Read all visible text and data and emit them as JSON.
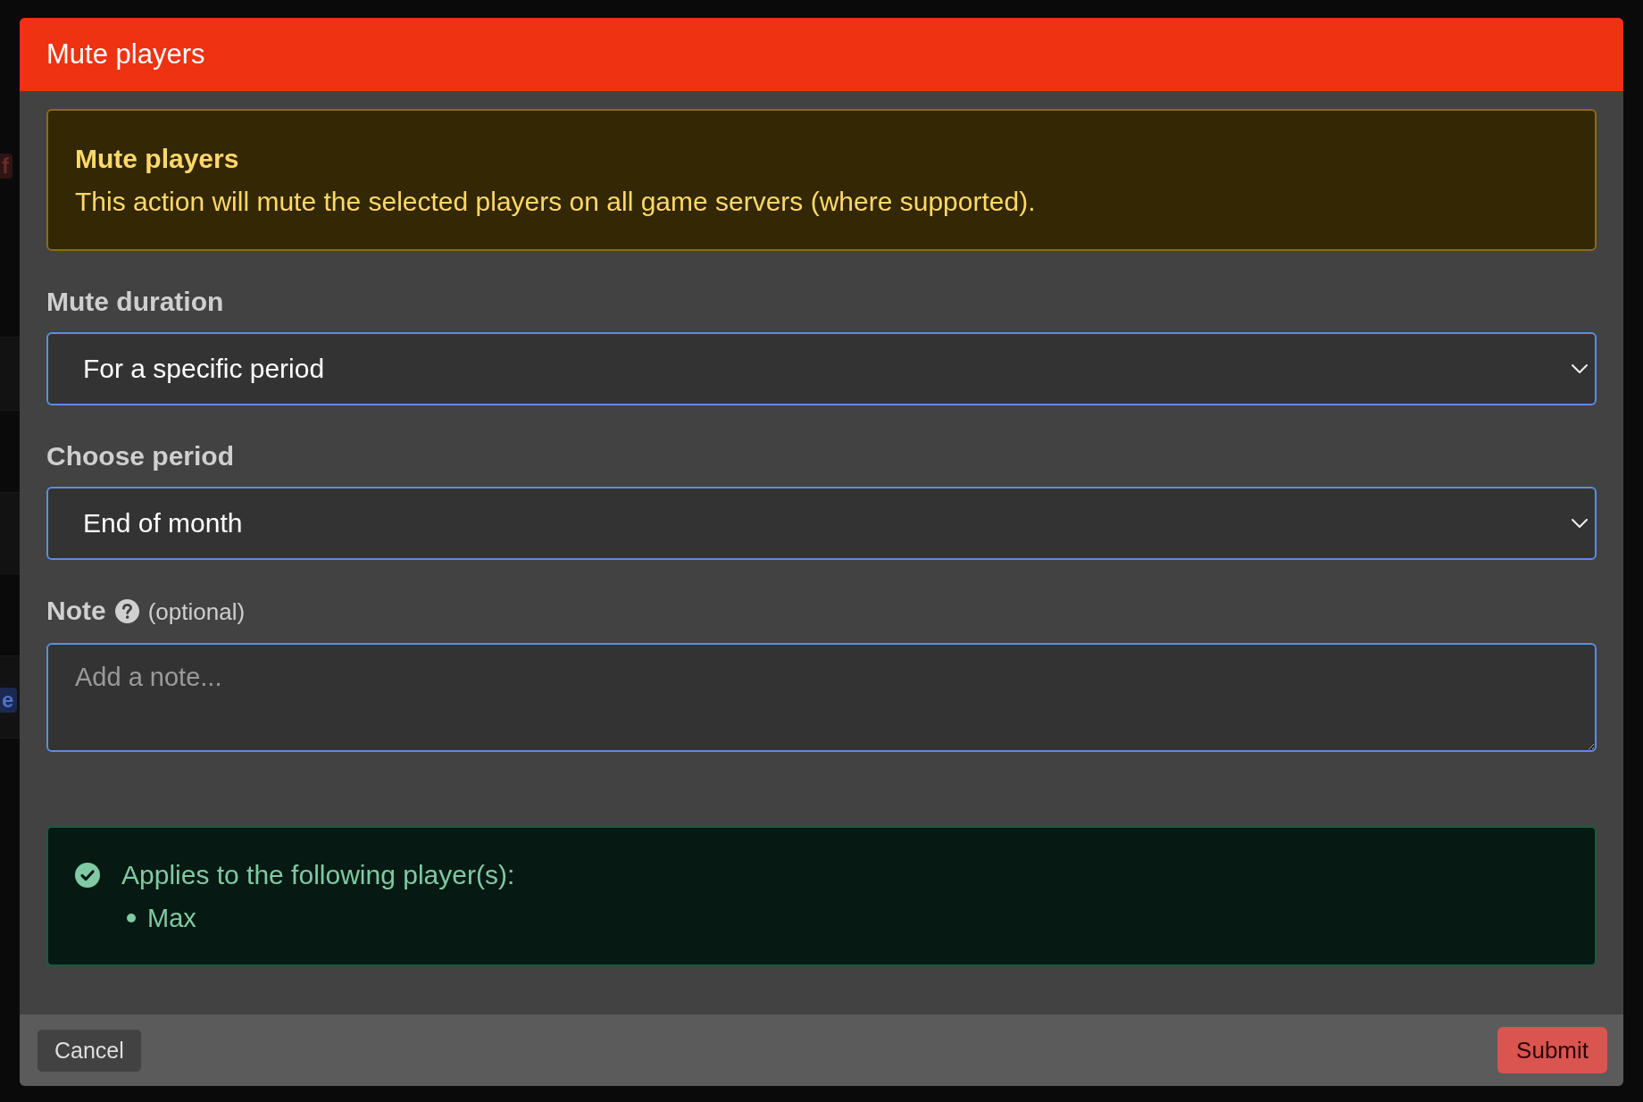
{
  "background": {
    "tags": [
      {
        "text": "f",
        "color": "#2e1414"
      },
      {
        "text": "e",
        "color": "#1b2852"
      }
    ]
  },
  "dialog": {
    "title": "Mute players",
    "alert": {
      "title": "Mute players",
      "message": "This action will mute the selected players on all game servers (where supported)."
    },
    "fields": [
      {
        "kind": "select",
        "label": "Mute duration",
        "value": "For a specific period"
      },
      {
        "kind": "select",
        "label": "Choose period",
        "value": "End of month"
      },
      {
        "kind": "textarea",
        "label": "Note",
        "help_icon": true,
        "hint": "(optional)",
        "placeholder": "Add a note..."
      }
    ],
    "summary": {
      "title": "Applies to the following player(s):",
      "players": [
        "Max"
      ]
    },
    "buttons": [
      {
        "label": "Cancel",
        "kind": "secondary"
      },
      {
        "label": "Submit",
        "kind": "primary"
      }
    ]
  }
}
